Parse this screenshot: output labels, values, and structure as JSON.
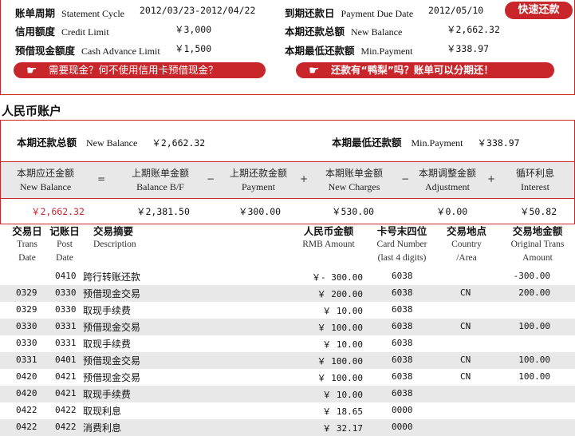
{
  "statement": {
    "cycle": {
      "label_cn": "账单周期",
      "label_en": "Statement Cycle",
      "value": "2012/03/23-2012/04/22"
    },
    "credit_limit": {
      "label_cn": "信用额度",
      "label_en": "Credit Limit",
      "value": "￥3,000"
    },
    "cash_advance_limit": {
      "label_cn": "预借现金额度",
      "label_en": "Cash Advance Limit",
      "value": "￥1,500"
    },
    "due_date": {
      "label_cn": "到期还款日",
      "label_en": "Payment Due Date",
      "value": "2012/05/10"
    },
    "new_balance": {
      "label_cn": "本期还款总额",
      "label_en": "New Balance",
      "value": "￥2,662.32"
    },
    "min_payment": {
      "label_cn": "本期最低还款额",
      "label_en": "Min.Payment",
      "value": "￥338.97"
    },
    "quick_pay_label": "快速还款",
    "banner_left": "需要现金？何不使用信用卡预借现金？",
    "banner_right": "还款有“鸭梨”吗？账单可以分期还！"
  },
  "rmb_account": {
    "title": "人民币账户",
    "new_balance": {
      "label_cn": "本期还款总额",
      "label_en": "New Balance",
      "value": "￥2,662.32"
    },
    "min_payment": {
      "label_cn": "本期最低还款额",
      "label_en": "Min.Payment",
      "value": "￥338.97"
    },
    "equation": [
      {
        "cn": "本期应还金额",
        "en": "New Balance",
        "value": "￥2,662.32"
      },
      {
        "cn": "上期账单金额",
        "en": "Balance B/F",
        "value": "￥2,381.50"
      },
      {
        "cn": "上期还款金额",
        "en": "Payment",
        "value": "￥300.00"
      },
      {
        "cn": "本期账单金额",
        "en": "New Charges",
        "value": "￥530.00"
      },
      {
        "cn": "本期调整金额",
        "en": "Adjustment",
        "value": "￥0.00"
      },
      {
        "cn": "循环利息",
        "en": "Interest",
        "value": "￥50.82"
      }
    ],
    "operators": [
      "=",
      "−",
      "+",
      "−",
      "+"
    ]
  },
  "transactions": {
    "headers": {
      "trans_date": {
        "cn": "交易日",
        "en1": "Trans",
        "en2": "Date"
      },
      "post_date": {
        "cn": "记账日",
        "en1": "Post",
        "en2": "Date"
      },
      "description": {
        "cn": "交易摘要",
        "en1": "",
        "en2": "Description"
      },
      "rmb_amount": {
        "cn": "人民币金额",
        "en1": "",
        "en2": "RMB Amount"
      },
      "card_number": {
        "cn": "卡号末四位",
        "en1": "Card Number",
        "en2": "(last 4 digits)"
      },
      "country": {
        "cn": "交易地点",
        "en1": "Country",
        "en2": "/Area"
      },
      "original_amount": {
        "cn": "交易地金额",
        "en1": "Original Trans",
        "en2": "Amount"
      }
    },
    "rows": [
      {
        "trans": "",
        "post": "0410",
        "desc": "跨行转账还款",
        "amount": "￥- 300.00",
        "card": "6038",
        "country": "",
        "orig": "-300.00"
      },
      {
        "trans": "0329",
        "post": "0330",
        "desc": "预借现金交易",
        "amount": "￥ 200.00",
        "card": "6038",
        "country": "CN",
        "orig": "200.00"
      },
      {
        "trans": "0329",
        "post": "0330",
        "desc": "取现手续费",
        "amount": "￥ 10.00",
        "card": "6038",
        "country": "",
        "orig": ""
      },
      {
        "trans": "0330",
        "post": "0331",
        "desc": "预借现金交易",
        "amount": "￥ 100.00",
        "card": "6038",
        "country": "CN",
        "orig": "100.00"
      },
      {
        "trans": "0330",
        "post": "0331",
        "desc": "取现手续费",
        "amount": "￥ 10.00",
        "card": "6038",
        "country": "",
        "orig": ""
      },
      {
        "trans": "0331",
        "post": "0401",
        "desc": "预借现金交易",
        "amount": "￥ 100.00",
        "card": "6038",
        "country": "CN",
        "orig": "100.00"
      },
      {
        "trans": "0420",
        "post": "0421",
        "desc": "预借现金交易",
        "amount": "￥ 100.00",
        "card": "6038",
        "country": "CN",
        "orig": "100.00"
      },
      {
        "trans": "0420",
        "post": "0421",
        "desc": "取现手续费",
        "amount": "￥ 10.00",
        "card": "6038",
        "country": "",
        "orig": ""
      },
      {
        "trans": "0422",
        "post": "0422",
        "desc": "取现利息",
        "amount": "￥ 18.65",
        "card": "0000",
        "country": "",
        "orig": ""
      },
      {
        "trans": "0422",
        "post": "0422",
        "desc": "消费利息",
        "amount": "￥ 32.17",
        "card": "0000",
        "country": "",
        "orig": ""
      }
    ]
  },
  "colors": {
    "accent": "#c9262c",
    "stripe": "#e8e8e8"
  }
}
